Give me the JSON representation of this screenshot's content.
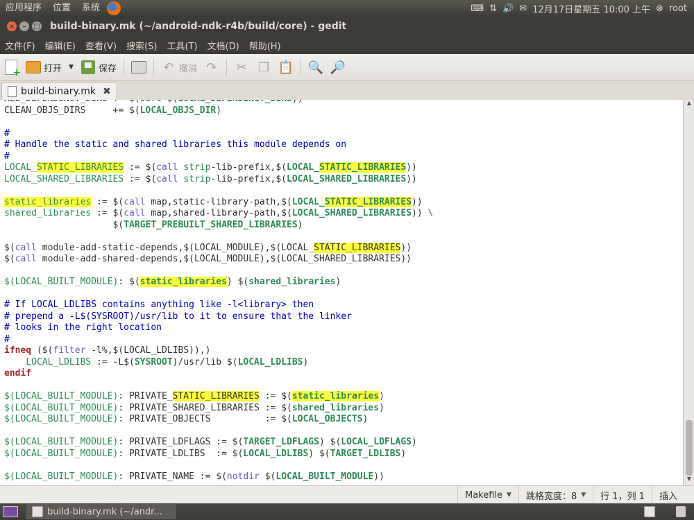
{
  "top_panel": {
    "menu_apps": "应用程序",
    "menu_places": "位置",
    "menu_system": "系统",
    "datetime": "12月17日星期五 10:00 上午",
    "user": "root"
  },
  "window": {
    "title": "build-binary.mk (~/android-ndk-r4b/build/core) - gedit"
  },
  "menubar": {
    "items": [
      "文件(F)",
      "编辑(E)",
      "查看(V)",
      "搜索(S)",
      "工具(T)",
      "文档(D)",
      "帮助(H)"
    ]
  },
  "toolbar": {
    "open_label": "打开",
    "save_label": "保存",
    "undo_label": "撤消"
  },
  "tab": {
    "label": "build-binary.mk"
  },
  "statusbar": {
    "language": "Makefile",
    "tab_width": "跳格宽度：8",
    "position": "行 1，列 1",
    "mode": "插入"
  },
  "taskbar": {
    "task_label": "build-binary.mk (~/andr..."
  },
  "icons": {
    "new": "new-document-icon",
    "open": "folder-open-icon",
    "save": "save-icon",
    "print": "print-icon",
    "undo": "undo-icon",
    "redo": "redo-icon",
    "cut": "cut-icon",
    "copy": "copy-icon",
    "paste": "paste-icon",
    "find": "search-icon",
    "replace": "find-replace-icon"
  },
  "colors": {
    "highlight": "#ffff3b",
    "comment": "#0000bf",
    "keyword": "#a52a2a",
    "function": "#6a5acd",
    "variable": "#2e8b57"
  }
}
